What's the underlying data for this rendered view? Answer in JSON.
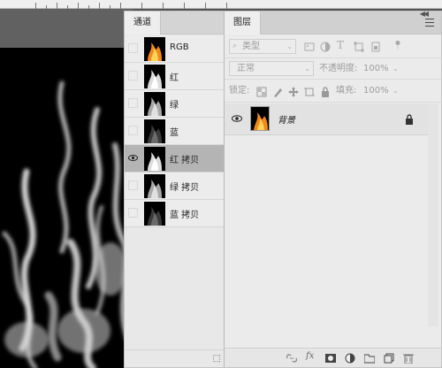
{
  "channels_panel": {
    "tab_label": "通道",
    "rows": [
      {
        "label": "RGB",
        "selected": false
      },
      {
        "label": "红",
        "selected": false
      },
      {
        "label": "绿",
        "selected": false
      },
      {
        "label": "蓝",
        "selected": false
      },
      {
        "label": "红 拷贝",
        "selected": true
      },
      {
        "label": "绿 拷贝",
        "selected": false
      },
      {
        "label": "蓝 拷贝",
        "selected": false
      }
    ]
  },
  "layers_panel": {
    "tab_label": "图层",
    "filter": {
      "placeholder": "类型"
    },
    "blend_mode": "正常",
    "opacity": {
      "label": "不透明度:",
      "value": "100%"
    },
    "lock_label": "锁定:",
    "fill": {
      "label": "填充:",
      "value": "100%"
    },
    "layers": [
      {
        "name": "背景",
        "locked": true,
        "visible": true
      }
    ],
    "footer_icons": [
      "link-icon",
      "fx-icon",
      "mask-icon",
      "adjustment-icon",
      "folder-icon",
      "new-layer-icon",
      "trash-icon"
    ]
  },
  "colors": {
    "workspace": "#535353",
    "panel_bg": "#eeeeee",
    "selected_row": "#b4b4b4"
  }
}
